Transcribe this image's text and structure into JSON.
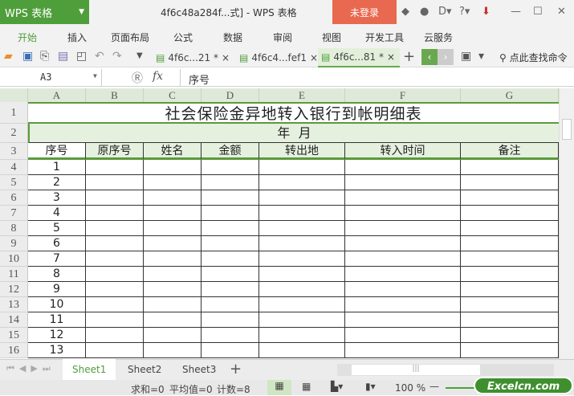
{
  "app": {
    "name": "WPS 表格",
    "window_title": "4f6c48a284f...式] - WPS 表格",
    "login": "未登录"
  },
  "menu": [
    "开始",
    "插入",
    "页面布局",
    "公式",
    "数据",
    "审阅",
    "视图",
    "开发工具",
    "云服务"
  ],
  "doc_tabs": [
    {
      "label": "4f6c...21 *"
    },
    {
      "label": "4f6c4...fef1"
    },
    {
      "label": "4f6c...81 *"
    }
  ],
  "search_cmd": "点此查找命令",
  "formula_bar": {
    "cell_ref": "A3",
    "fx": "fx",
    "value": "序号"
  },
  "columns": [
    "A",
    "B",
    "C",
    "D",
    "E",
    "F",
    "G"
  ],
  "rows": [
    "1",
    "2",
    "3",
    "4",
    "5",
    "6",
    "7",
    "8",
    "9",
    "10",
    "11",
    "12",
    "13",
    "14",
    "15",
    "16"
  ],
  "sheet": {
    "title": "社会保险金异地转入银行到帐明细表",
    "subtitle": "年  月",
    "headers": [
      "序号",
      "原序号",
      "姓名",
      "金额",
      "转出地",
      "转入时间",
      "备注"
    ],
    "seq": [
      "1",
      "2",
      "3",
      "4",
      "5",
      "6",
      "7",
      "8",
      "9",
      "10",
      "11",
      "12",
      "13"
    ]
  },
  "sheet_tabs": [
    "Sheet1",
    "Sheet2",
    "Sheet3"
  ],
  "status": {
    "sum": "求和=0",
    "avg": "平均值=0",
    "count": "计数=8",
    "zoom": "100 %"
  },
  "watermark": "Excelcn.com",
  "colors": {
    "accent": "#4f9e3c",
    "login": "#e8694f",
    "grid_border": "#5b9a3c"
  }
}
